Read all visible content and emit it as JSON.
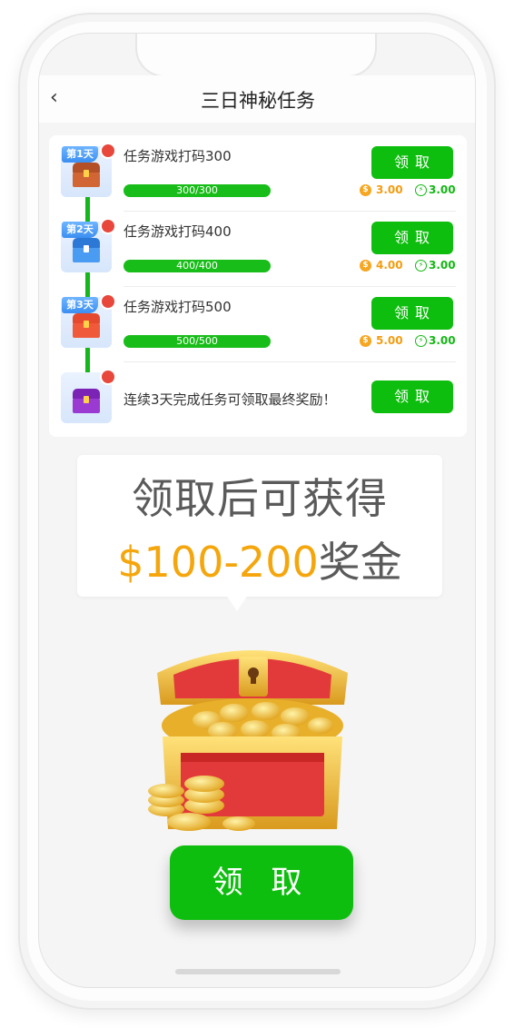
{
  "header": {
    "back_icon": "chevron-left-icon",
    "title": "三日神秘任务"
  },
  "tasks": [
    {
      "day": "第1天",
      "title": "任务游戏打码300",
      "progress": "300/300",
      "progress_ratio": 1.0,
      "button": "领 取",
      "coin": "3.00",
      "bolt": "3.00",
      "chest_color": "#c9582a"
    },
    {
      "day": "第2天",
      "title": "任务游戏打码400",
      "progress": "400/400",
      "progress_ratio": 1.0,
      "button": "领 取",
      "coin": "4.00",
      "bolt": "3.00",
      "chest_color": "#3a8eea"
    },
    {
      "day": "第3天",
      "title": "任务游戏打码500",
      "progress": "500/500",
      "progress_ratio": 1.0,
      "button": "领 取",
      "coin": "5.00",
      "bolt": "3.00",
      "chest_color": "#e8432f"
    }
  ],
  "final_task": {
    "text": "连续3天完成任务可领取最终奖励！",
    "button": "领 取",
    "chest_color": "#8a2fc2"
  },
  "bubble": {
    "line1": "领取后可获得",
    "amount": "$100-200",
    "suffix": "奖金"
  },
  "main_button": "领 取",
  "colors": {
    "accent_green": "#0ebe0e",
    "coin_orange": "#f39c12",
    "dot_red": "#e8473c"
  }
}
